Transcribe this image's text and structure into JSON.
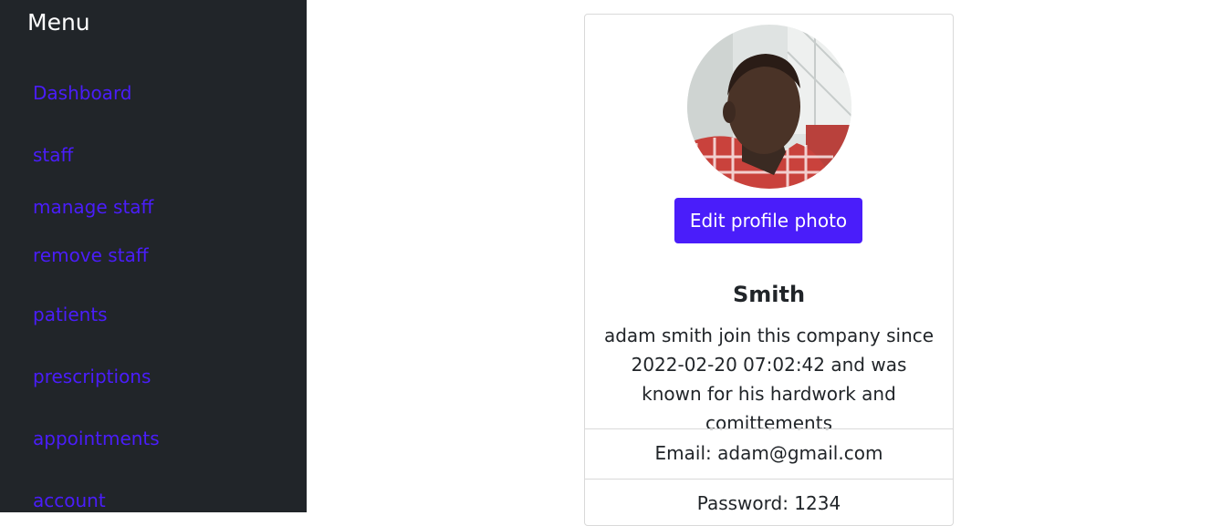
{
  "sidebar": {
    "title": "Menu",
    "items": [
      {
        "label": "Dashboard"
      },
      {
        "label": "staff"
      },
      {
        "label": "manage staff"
      },
      {
        "label": "remove staff"
      },
      {
        "label": "patients"
      },
      {
        "label": "prescriptions"
      },
      {
        "label": "appointments"
      },
      {
        "label": "account"
      }
    ]
  },
  "profile": {
    "edit_photo_label": "Edit profile photo",
    "name": "Smith",
    "bio": "adam smith join this company since 2022-02-20 07:02:42 and was known for his hardwork and comittements",
    "email": "Email: adam@gmail.com",
    "password": "Password: 1234"
  },
  "colors": {
    "sidebar_bg": "#212529",
    "accent": "#4a1dfa"
  }
}
